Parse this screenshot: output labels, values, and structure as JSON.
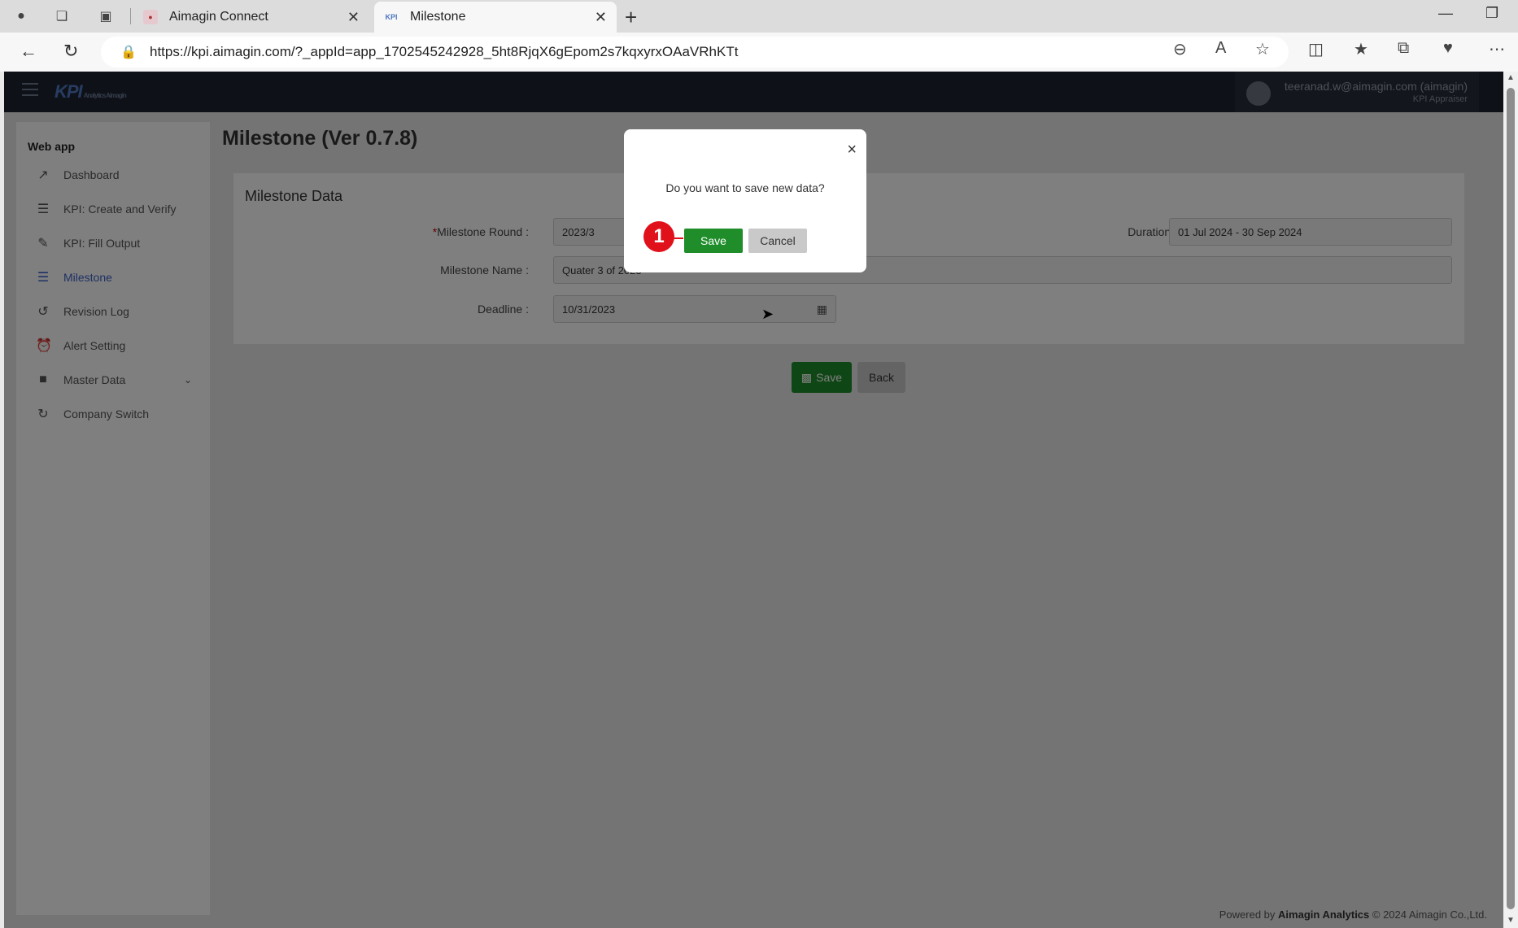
{
  "browser": {
    "tabs": [
      {
        "title": "Aimagin Connect"
      },
      {
        "title": "Milestone"
      }
    ],
    "url": "https://kpi.aimagin.com/?_appId=app_1702545242928_5ht8RjqX6gEpom2s7kqxyrxOAaVRhKTt"
  },
  "app": {
    "logo": "KPI",
    "logo_sub": "Analytics Aimagin",
    "user": {
      "email": "teeranad.w@aimagin.com (aimagin)",
      "role": "KPI Appraiser"
    }
  },
  "sidebar": {
    "title": "Web app",
    "items": [
      {
        "label": "Dashboard",
        "icon": "chart-line-icon"
      },
      {
        "label": "KPI: Create and Verify",
        "icon": "list-check-icon"
      },
      {
        "label": "KPI: Fill Output",
        "icon": "edit-icon"
      },
      {
        "label": "Milestone",
        "icon": "list-icon"
      },
      {
        "label": "Revision Log",
        "icon": "history-icon"
      },
      {
        "label": "Alert Setting",
        "icon": "alarm-icon"
      },
      {
        "label": "Master Data",
        "icon": "folder-icon"
      },
      {
        "label": "Company Switch",
        "icon": "refresh-icon"
      }
    ]
  },
  "page": {
    "title": "Milestone (Ver 0.7.8)",
    "card_title": "Milestone Data",
    "fields": {
      "round_label": "Milestone Round :",
      "round_value": "2023/3",
      "duration_label": "Duration :",
      "duration_value": "01 Jul 2024 - 30 Sep 2024",
      "name_label": "Milestone Name :",
      "name_value": "Quater 3 of 2023",
      "deadline_label": "Deadline :",
      "deadline_value": "10/31/2023"
    },
    "save_label": "Save",
    "back_label": "Back"
  },
  "modal": {
    "message": "Do you want to save new data?",
    "save_label": "Save",
    "cancel_label": "Cancel",
    "close_label": "×"
  },
  "annotation": {
    "step": "1"
  },
  "footer": {
    "prefix": "Powered by",
    "brand": "Aimagin Analytics",
    "suffix": "© 2024 Aimagin Co.,Ltd."
  },
  "colors": {
    "header": "#1c2331",
    "accent": "#3d63c8",
    "save_green": "#1f8d2a",
    "step_red": "#e1111b"
  }
}
